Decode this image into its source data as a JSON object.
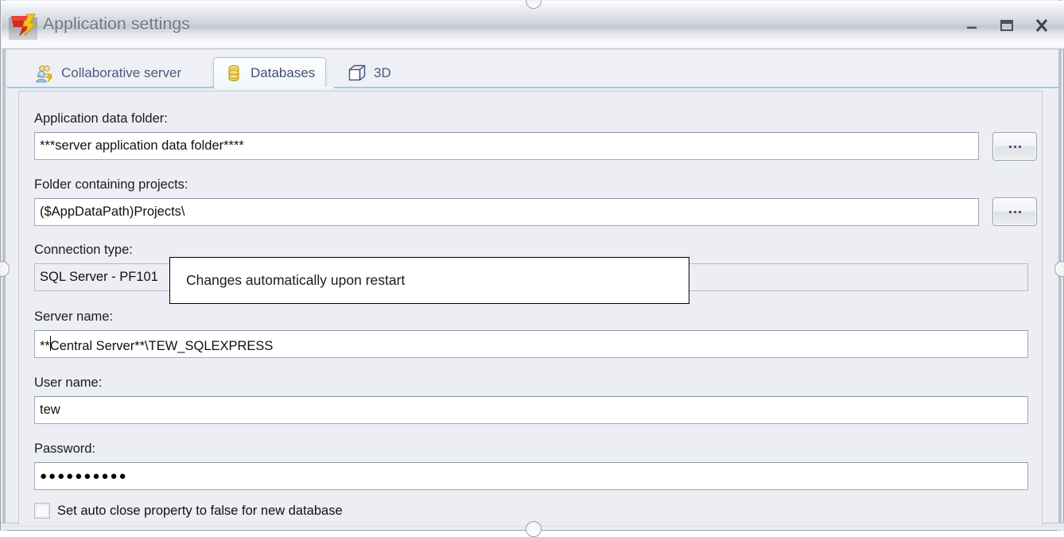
{
  "window": {
    "title": "Application settings",
    "icon": "app-logo-icon",
    "controls": {
      "minimize": "Minimize",
      "maximize": "Maximize",
      "close": "Close"
    }
  },
  "tabs": [
    {
      "label": "Collaborative server",
      "icon": "users-icon",
      "selected": false
    },
    {
      "label": "Databases",
      "icon": "database-icon",
      "selected": true
    },
    {
      "label": "3D",
      "icon": "cube-icon",
      "selected": false
    }
  ],
  "form": {
    "app_data_folder": {
      "label": "Application data folder:",
      "value": "***server application data folder****",
      "browse_label": "..."
    },
    "projects_folder": {
      "label": "Folder containing projects:",
      "value": "($AppDataPath)Projects\\",
      "browse_label": "..."
    },
    "connection_type": {
      "label": "Connection type:",
      "value": "SQL Server - PF101"
    },
    "server_name": {
      "label": "Server name:",
      "value": "**Central Server**\\TEW_SQLEXPRESS"
    },
    "user_name": {
      "label": "User name:",
      "value": "tew"
    },
    "password": {
      "label": "Password:",
      "value": "●●●●●●●●●●"
    },
    "auto_close": {
      "label": "Set auto close property to false for new database",
      "checked": false
    }
  },
  "tooltip": {
    "text": "Changes automatically upon restart"
  },
  "colors": {
    "window_bg": "#eceef4",
    "title_text": "#6b7585",
    "tab_text": "#4a5b7d",
    "selected_tab_underline": "#9ecbe6",
    "field_border": "#a3abb8"
  }
}
